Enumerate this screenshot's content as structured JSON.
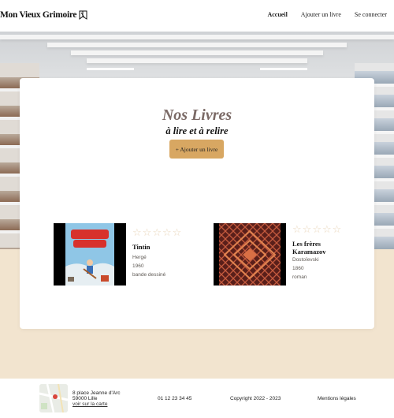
{
  "header": {
    "logo_text": "Mon Vieux Grimoire",
    "nav": [
      {
        "label": "Accueil",
        "active": true
      },
      {
        "label": "Ajouter un livre",
        "active": false
      },
      {
        "label": "Se connecter",
        "active": false
      }
    ]
  },
  "main": {
    "title": "Nos Livres",
    "subtitle": "à lire et à relire",
    "add_button": "+ Ajouter un livre",
    "books": [
      {
        "title": "Tintin",
        "author": "Hergé",
        "year": "1960",
        "genre": "bande dessiné",
        "rating": 0,
        "max_rating": 5
      },
      {
        "title": "Les frères Karamazov",
        "author": "Dostoïevski",
        "year": "1860",
        "genre": "roman",
        "rating": 0,
        "max_rating": 5
      }
    ]
  },
  "footer": {
    "address_line1": "8 place Jeanne d'Arc",
    "address_line2": "59000 Lille",
    "map_link": "voir sur la carte",
    "phone": "01 12 23 34 45",
    "copyright": "Copyright 2022 - 2023",
    "legal": "Mentions légales"
  },
  "colors": {
    "accent": "#d8a762",
    "page_bg": "#f2e4cf",
    "star_empty": "#ead7bd",
    "title": "#7b6a66"
  }
}
